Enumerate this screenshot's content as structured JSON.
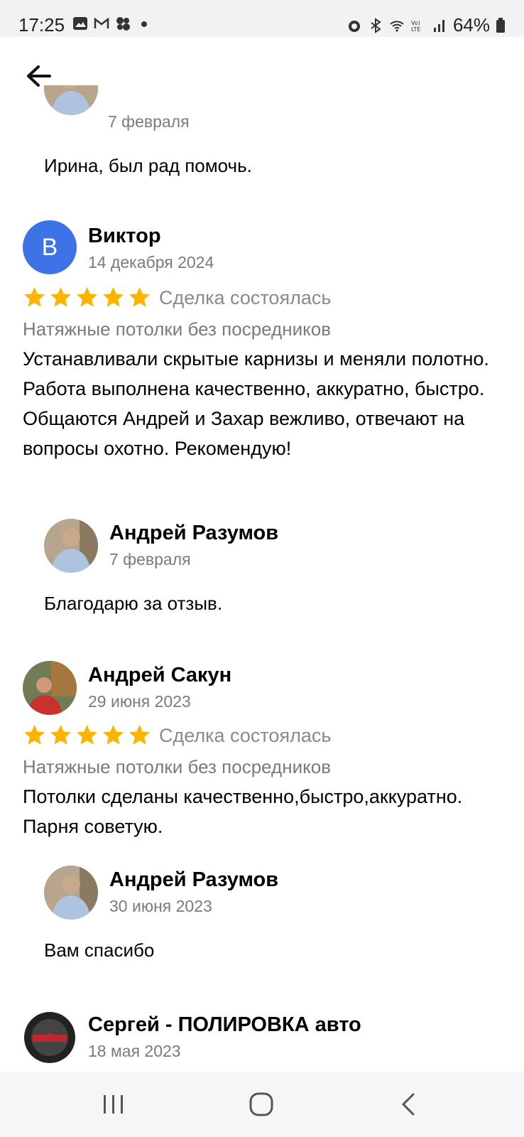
{
  "status_bar": {
    "time": "17:25",
    "battery": "64%",
    "left_icons": [
      "gallery-icon",
      "gmail-icon",
      "apps-icon",
      "dot-icon"
    ],
    "right_icons": [
      "alarm-icon",
      "bluetooth-icon",
      "wifi-icon",
      "volte-icon",
      "signal-icon",
      "battery-icon"
    ]
  },
  "top_bar": {
    "back_icon": "arrow-left-icon"
  },
  "reviews": [
    {
      "reply": {
        "date": "7 февраля",
        "text": "Ирина, был рад помочь."
      }
    },
    {
      "author": "Виктор",
      "avatar_letter": "В",
      "date": "14 декабря 2024",
      "rating": 5,
      "deal_status": "Сделка состоялась",
      "company": "Натяжные потолки без посредников",
      "text": "Устанавливали скрытые карнизы и меняли полотно. Работа выполнена качественно, аккуратно, быстро. Общаются Андрей и Захар вежливо, отвечают на вопросы охотно. Рекомендую!",
      "reply": {
        "author": "Андрей Разумов",
        "date": "7 февраля",
        "text": "Благодарю за отзыв."
      }
    },
    {
      "author": "Андрей Сакун",
      "date": "29 июня 2023",
      "rating": 5,
      "deal_status": "Сделка состоялась",
      "company": "Натяжные потолки без посредников",
      "text": "Потолки сделаны качественно,быстро,аккуратно. Парня советую.",
      "reply": {
        "author": "Андрей Разумов",
        "date": "30 июня 2023",
        "text": "Вам спасибо"
      }
    },
    {
      "author": "Сергей - ПОЛИРОВКА авто",
      "date": "18 мая 2023"
    }
  ],
  "nav_bar": {
    "recent_icon": "recent-apps-icon",
    "home_icon": "home-icon",
    "back_icon": "back-chevron-icon"
  },
  "colors": {
    "star": "#fbb400",
    "avatar_blue": "#3e73e8",
    "secondary_text": "#7a7a7a"
  }
}
